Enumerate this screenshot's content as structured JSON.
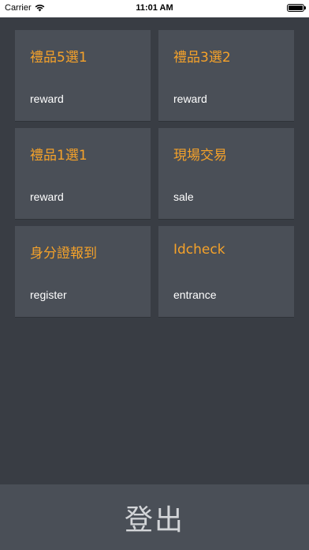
{
  "status_bar": {
    "carrier": "Carrier",
    "time": "11:01 AM"
  },
  "tiles": [
    {
      "title": "禮品5選1",
      "subtitle": "reward"
    },
    {
      "title": "禮品3選2",
      "subtitle": "reward"
    },
    {
      "title": "禮品1選1",
      "subtitle": "reward"
    },
    {
      "title": "現場交易",
      "subtitle": "sale"
    },
    {
      "title": "身分證報到",
      "subtitle": "register"
    },
    {
      "title": "Idcheck",
      "subtitle": "entrance"
    }
  ],
  "logout": {
    "label": "登出"
  },
  "colors": {
    "background": "#393d44",
    "tile": "#4a4f57",
    "accent": "#f5a22a",
    "logout_text": "#d3d5d8"
  },
  "icons": [
    "wifi-icon",
    "battery-icon"
  ]
}
